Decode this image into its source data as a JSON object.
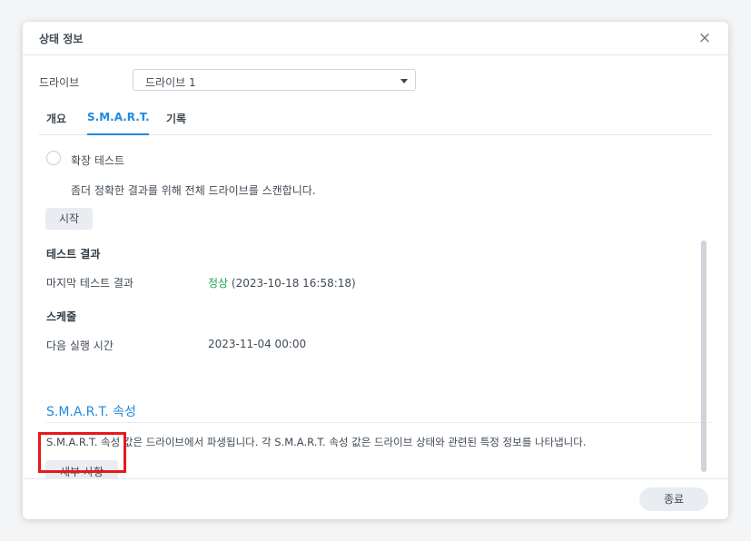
{
  "dialog": {
    "title": "상태 정보",
    "close_symbol": "×"
  },
  "drive": {
    "label": "드라이브",
    "selected": "드라이브 1"
  },
  "tabs": [
    {
      "label": "개요"
    },
    {
      "label": "S.M.A.R.T."
    },
    {
      "label": "기록"
    }
  ],
  "active_tab": "S.M.A.R.T.",
  "extended_test": {
    "label": "확장 테스트",
    "description": "좀더 정확한 결과를 위해 전체 드라이브를 스캔합니다.",
    "start_label": "시작"
  },
  "test_result": {
    "heading": "테스트 결과",
    "last_label": "마지막 테스트 결과",
    "status": "정상",
    "timestamp": "(2023-10-18 16:58:18)"
  },
  "schedule": {
    "heading": "스케줄",
    "next_label": "다음 실행 시간",
    "next_value": "2023-11-04 00:00"
  },
  "smart_attrs": {
    "heading": "S.M.A.R.T. 속성",
    "description": "S.M.A.R.T. 속성 값은 드라이브에서 파생됩니다. 각 S.M.A.R.T. 속성 값은 드라이브 상태와 관련된 특정 정보를 나타냅니다.",
    "details_label": "세부 사항"
  },
  "footer": {
    "close_label": "종료"
  },
  "colors": {
    "accent": "#1f8ae0",
    "status_ok": "#1fa650",
    "highlight": "#e6191b"
  }
}
